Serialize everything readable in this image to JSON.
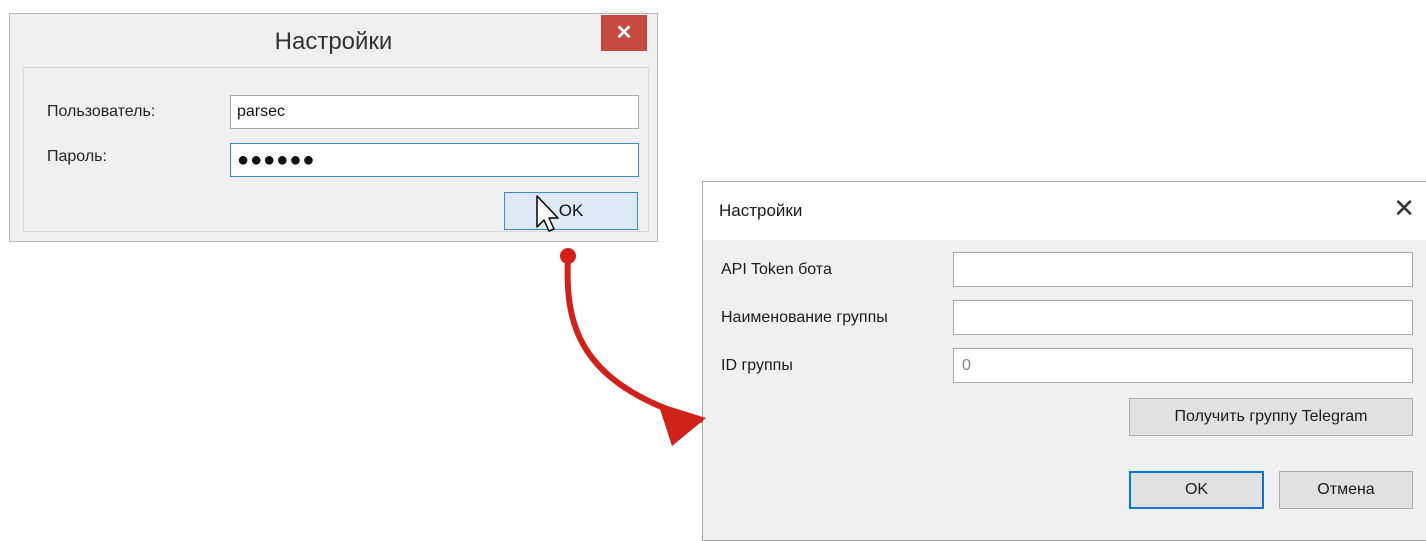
{
  "login_dialog": {
    "title": "Настройки",
    "close_glyph": "✕",
    "user_label": "Пользователь:",
    "user_value": "parsec",
    "password_label": "Пароль:",
    "password_value": "●●●●●●",
    "ok_label": "OK"
  },
  "settings_dialog": {
    "title": "Настройки",
    "close_glyph": "✕",
    "token_label": "API Token бота",
    "token_value": "",
    "group_name_label": "Наименование группы",
    "group_name_value": "",
    "group_id_label": "ID группы",
    "group_id_value": "0",
    "get_group_label": "Получить группу Telegram",
    "ok_label": "OK",
    "cancel_label": "Отмена"
  },
  "annotation": {
    "arrow_color": "#d0211b",
    "icons": [
      "mouse-cursor-icon",
      "red-arrow-icon"
    ]
  }
}
